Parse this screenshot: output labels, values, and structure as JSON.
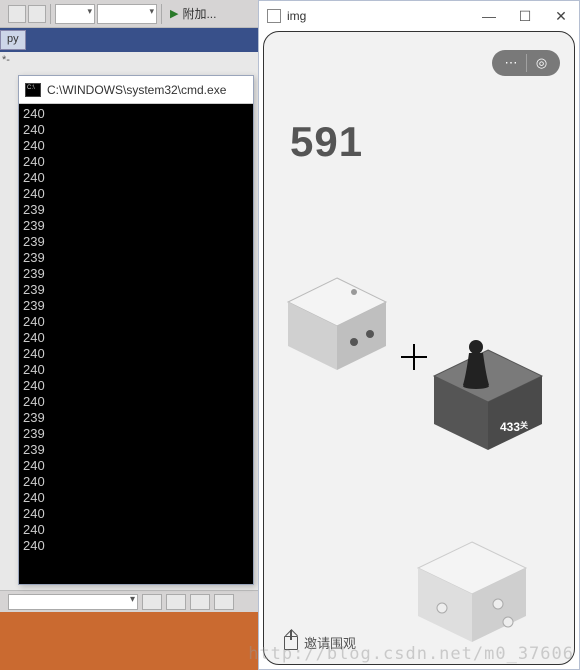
{
  "ide": {
    "attach_label": "附加...",
    "tab_label": "py",
    "stub_text": "*-"
  },
  "cmd": {
    "title": "C:\\WINDOWS\\system32\\cmd.exe",
    "lines": [
      "240",
      "240",
      "240",
      "240",
      "240",
      "240",
      "239",
      "239",
      "239",
      "239",
      "239",
      "239",
      "239",
      "240",
      "240",
      "240",
      "240",
      "240",
      "240",
      "239",
      "239",
      "239",
      "240",
      "240",
      "240",
      "240",
      "240",
      "240"
    ]
  },
  "img_window": {
    "title": "img"
  },
  "game": {
    "score": "591",
    "target_badge": "433",
    "target_badge_suffix": "关",
    "share_label": "邀请围观"
  },
  "watermark": "http://blog.csdn.net/m0_37606"
}
